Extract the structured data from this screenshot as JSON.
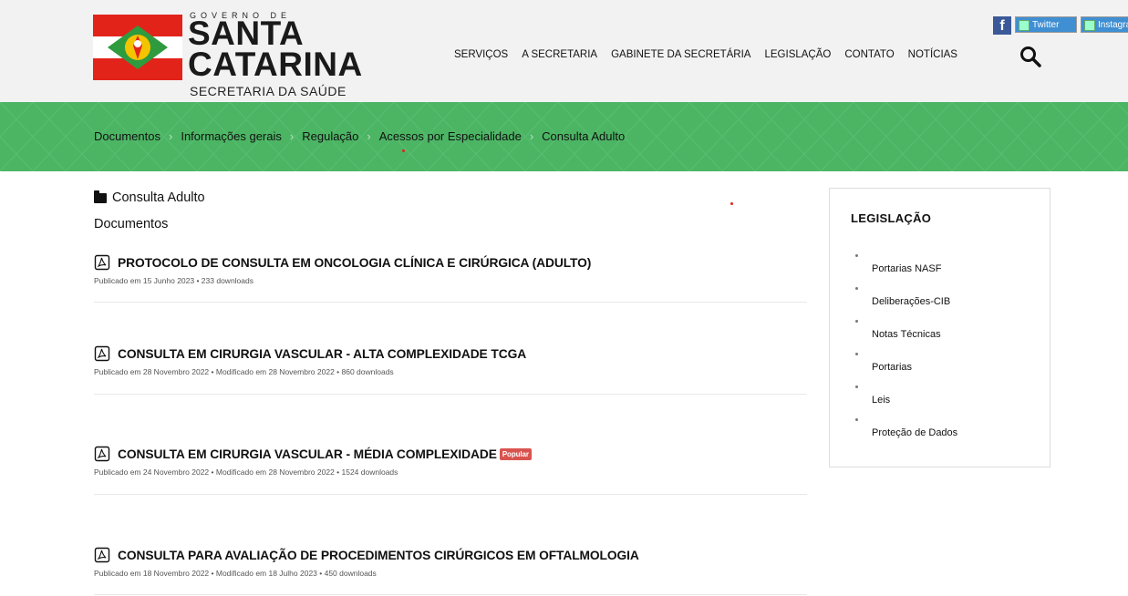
{
  "header": {
    "gov_label": "GOVERNO DE",
    "state_line1": "SANTA",
    "state_line2": "CATARINA",
    "dept_label": "SECRETARIA DA SAÚDE",
    "nav": [
      "SERVIÇOS",
      "A SECRETARIA",
      "GABINETE DA SECRETÁRIA",
      "LEGISLAÇÃO",
      "CONTATO",
      "NOTÍCIAS"
    ],
    "social": {
      "facebook": "f",
      "twitter": "Twitter",
      "instagram": "Instagram"
    }
  },
  "breadcrumb": [
    "Documentos",
    "Informações gerais",
    "Regulação",
    "Acessos por Especialidade",
    "Consulta Adulto"
  ],
  "main": {
    "folder_title": "Consulta Adulto",
    "section_title": "Documentos",
    "documents": [
      {
        "title": "PROTOCOLO DE CONSULTA EM ONCOLOGIA CLÍNICA E CIRÚRGICA (ADULTO)",
        "meta": "Publicado em 15 Junho 2023  •  233 downloads",
        "badge": ""
      },
      {
        "title": "CONSULTA EM CIRURGIA VASCULAR - ALTA COMPLEXIDADE TCGA",
        "meta": "Publicado em 28 Novembro 2022  •  Modificado em 28 Novembro 2022  •  860 downloads",
        "badge": ""
      },
      {
        "title": "CONSULTA EM CIRURGIA VASCULAR - MÉDIA COMPLEXIDADE",
        "meta": "Publicado em 24 Novembro 2022  •  Modificado em 28 Novembro 2022  •  1524 downloads",
        "badge": "Popular"
      },
      {
        "title": "CONSULTA PARA AVALIAÇÃO DE PROCEDIMENTOS CIRÚRGICOS EM OFTALMOLOGIA",
        "meta": "Publicado em 18 Novembro 2022  •  Modificado em 18 Julho 2023  •  450 downloads",
        "badge": ""
      }
    ]
  },
  "sidebar": {
    "title": "LEGISLAÇÃO",
    "items": [
      "Portarias NASF",
      "Deliberações-CIB",
      "Notas Técnicas",
      "Portarias",
      "Leis",
      "Proteção de Dados"
    ]
  },
  "colors": {
    "green_bar": "#4cb564",
    "red": "#e2231a",
    "popular": "#d9534f"
  }
}
